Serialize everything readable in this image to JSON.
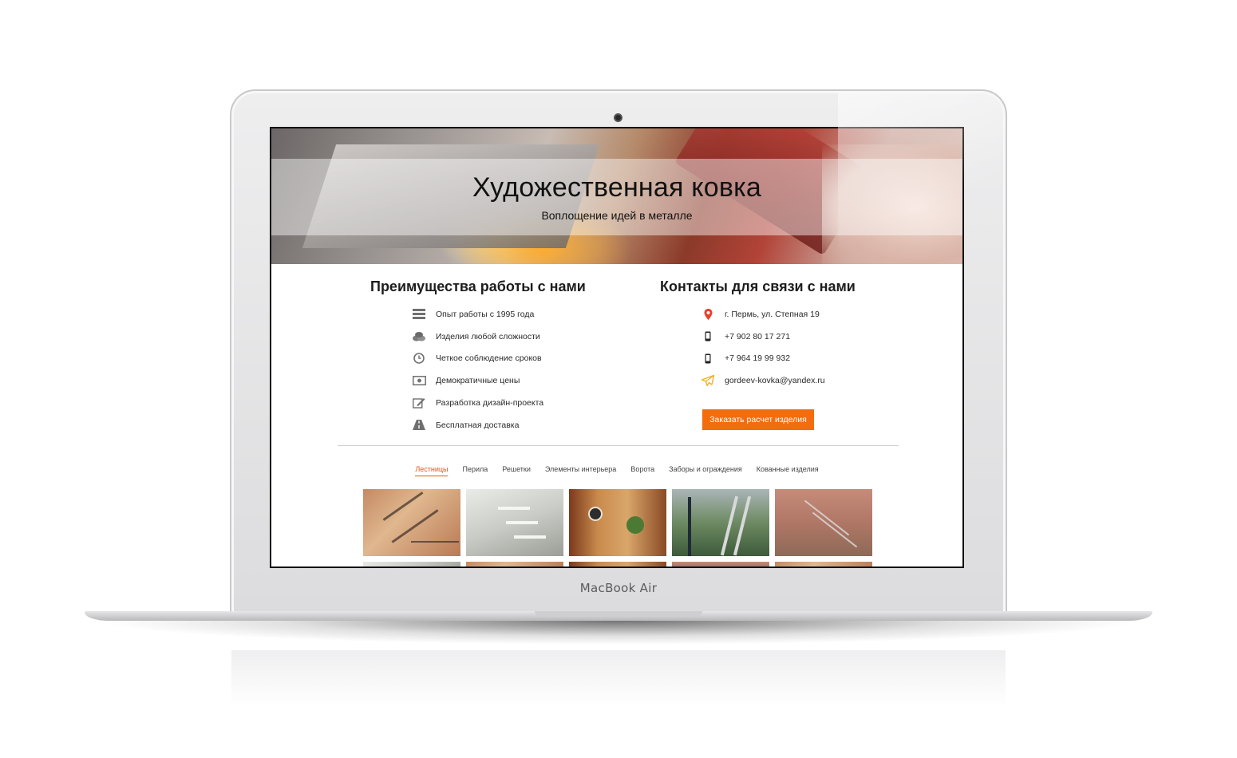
{
  "device": {
    "brand_label": "MacBook Air"
  },
  "hero": {
    "title": "Художественная ковка",
    "subtitle": "Воплощение идей в металле"
  },
  "advantages": {
    "title": "Преимущества работы с нами",
    "items": [
      {
        "icon": "layers-icon",
        "label": "Опыт работы с 1995 года"
      },
      {
        "icon": "coins-icon",
        "label": "Изделия любой сложности"
      },
      {
        "icon": "clock-icon",
        "label": "Четкое соблюдение сроков"
      },
      {
        "icon": "banknote-icon",
        "label": "Демократичные цены"
      },
      {
        "icon": "pencil-icon",
        "label": "Разработка дизайн-проекта"
      },
      {
        "icon": "road-icon",
        "label": "Бесплатная доставка"
      }
    ]
  },
  "contacts": {
    "title": "Контакты для связи с нами",
    "items": [
      {
        "icon": "map-pin-icon",
        "label": "г. Пермь, ул. Степная 19"
      },
      {
        "icon": "phone-icon",
        "label": "+7 902 80 17 271"
      },
      {
        "icon": "phone-icon",
        "label": "+7 964 19 99 932"
      },
      {
        "icon": "paper-plane-icon",
        "label": "gordeev-kovka@yandex.ru"
      }
    ],
    "cta_label": "Заказать расчет изделия"
  },
  "gallery": {
    "tabs": [
      {
        "label": "Лестницы",
        "active": true
      },
      {
        "label": "Перила",
        "active": false
      },
      {
        "label": "Решетки",
        "active": false
      },
      {
        "label": "Элементы интерьера",
        "active": false
      },
      {
        "label": "Ворота",
        "active": false
      },
      {
        "label": "Заборы и ограждения",
        "active": false
      },
      {
        "label": "Кованные изделия",
        "active": false
      }
    ]
  },
  "colors": {
    "accent": "#f26d0f",
    "active_tab": "#e8541a",
    "pin": "#e8402a",
    "plane": "#f2b21f"
  }
}
